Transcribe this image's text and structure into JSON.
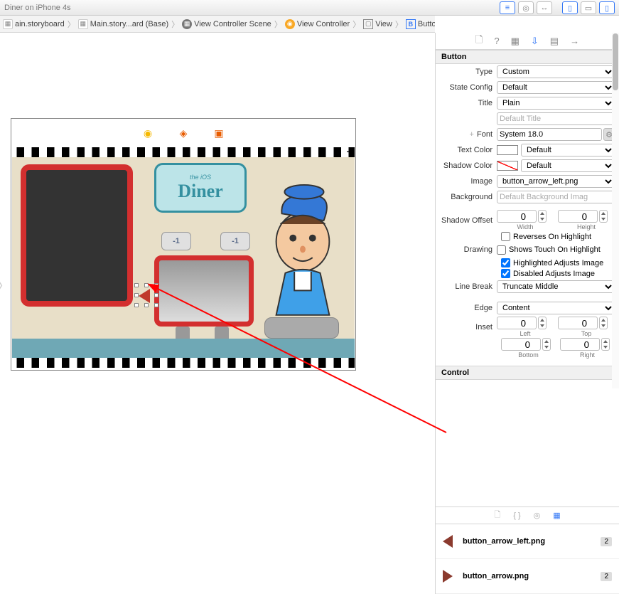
{
  "titlebar": "Diner on iPhone 4s",
  "breadcrumb": [
    {
      "label": "ain.storyboard"
    },
    {
      "label": "Main.story...ard (Base)"
    },
    {
      "label": "View Controller Scene"
    },
    {
      "label": "View Controller"
    },
    {
      "label": "View"
    },
    {
      "label": "Button"
    }
  ],
  "diner": {
    "logo_top": "the iOS",
    "logo_main": "Diner",
    "btn1": "-1",
    "btn2": "-1"
  },
  "inspector": {
    "section": "Button",
    "type_label": "Type",
    "type": "Custom",
    "state_label": "State Config",
    "state": "Default",
    "title_label": "Title",
    "title": "Plain",
    "title_placeholder": "Default Title",
    "font_label": "Font",
    "font": "System 18.0",
    "textcolor_label": "Text Color",
    "textcolor": "Default",
    "shadowcolor_label": "Shadow Color",
    "shadowcolor": "Default",
    "image_label": "Image",
    "image": "button_arrow_left.png",
    "bg_label": "Background",
    "bg_placeholder": "Default Background Imag",
    "shadowoffset_label": "Shadow Offset",
    "width_val": "0",
    "height_val": "0",
    "width_sub": "Width",
    "height_sub": "Height",
    "reverses": "Reverses On Highlight",
    "drawing_label": "Drawing",
    "shows": "Shows Touch On Highlight",
    "highlighted": "Highlighted Adjusts Image",
    "disabled": "Disabled Adjusts Image",
    "linebreak_label": "Line Break",
    "linebreak": "Truncate Middle",
    "edge_label": "Edge",
    "edge": "Content",
    "inset_label": "Inset",
    "left_val": "0",
    "top_val": "0",
    "left_sub": "Left",
    "top_sub": "Top",
    "bottom_val": "0",
    "right_val": "0",
    "bottom_sub": "Bottom",
    "right_sub": "Right",
    "section2": "Control"
  },
  "library": {
    "item1": "button_arrow_left.png",
    "badge1": "2",
    "item2": "button_arrow.png",
    "badge2": "2"
  }
}
